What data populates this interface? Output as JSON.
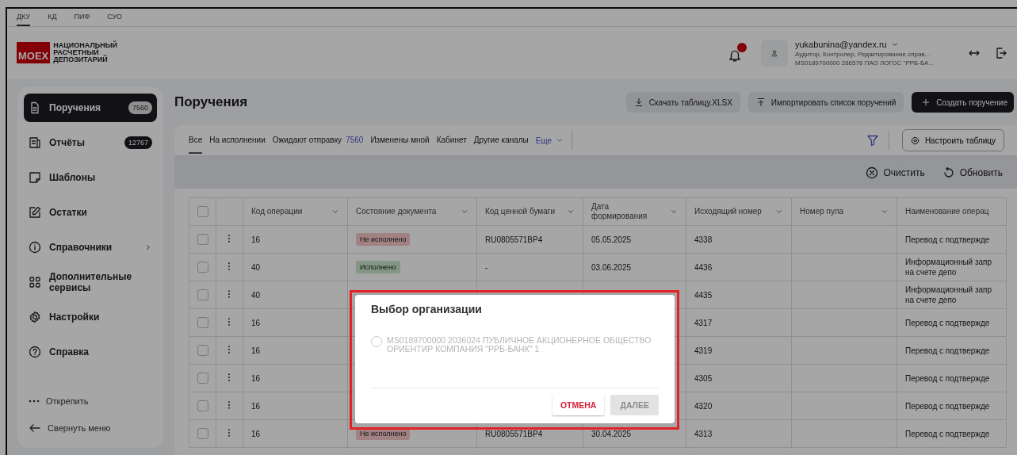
{
  "env_tabs": [
    {
      "label": "ДКУ",
      "selected": true
    },
    {
      "label": "КД",
      "selected": false
    },
    {
      "label": "ПИФ",
      "selected": false
    },
    {
      "label": "СУО",
      "selected": false
    }
  ],
  "logo": {
    "mark": "MOEX",
    "lines": [
      "НАЦИОНАЛЬНЫЙ",
      "РАСЧЕТНЫЙ",
      "ДЕПОЗИТАРИЙ"
    ]
  },
  "user": {
    "email": "yukabunina@yandex.ru",
    "roles": "Аудитор, Контролер, Редактирование справ...",
    "org": "MS0189700000 286576 ПАО ЛОГОС \"РРБ-БА..."
  },
  "sidebar": {
    "items": [
      {
        "label": "Поручения",
        "badge": "7560",
        "selected": true,
        "submenu": false
      },
      {
        "label": "Отчёты",
        "badge": "12767",
        "selected": false,
        "submenu": false
      },
      {
        "label": "Шаблоны",
        "selected": false,
        "submenu": false
      },
      {
        "label": "Остатки",
        "selected": false,
        "submenu": false
      },
      {
        "label": "Справочники",
        "selected": false,
        "submenu": true
      },
      {
        "label": "Дополнительные сервисы",
        "selected": false,
        "submenu": false
      },
      {
        "label": "Настройки",
        "selected": false,
        "submenu": false
      },
      {
        "label": "Справка",
        "selected": false,
        "submenu": false
      }
    ],
    "actions": [
      {
        "label": "Открепить"
      },
      {
        "label": "Свернуть меню"
      }
    ]
  },
  "page_title": "Поручения",
  "buttons": [
    {
      "kind": "download",
      "label": "Скачать таблицу.XLSX"
    },
    {
      "kind": "upload",
      "label": "Импортировать список поручений"
    },
    {
      "kind": "create",
      "label": "Создать поручение"
    }
  ],
  "filter_tabs": [
    {
      "label": "Все",
      "selected": true
    },
    {
      "label": "На исполнении",
      "selected": false
    },
    {
      "label": "Ожидают отправку",
      "count": "7560",
      "selected": false
    },
    {
      "label": "Изменены мной",
      "selected": false
    },
    {
      "label": "Кабинет",
      "selected": false
    },
    {
      "label": "Другие каналы",
      "selected": false
    }
  ],
  "more_link": "Еще",
  "configure_button": "Настроить таблицу",
  "clear_button": "Очистить",
  "refresh_button": "Обновить",
  "table": {
    "all_checked": false,
    "columns": [
      {
        "label": "Код операции",
        "sortable": true
      },
      {
        "label": "Состояние документа",
        "sortable": true
      },
      {
        "label": "Код ценной бумаги",
        "sortable": true
      },
      {
        "label": "Дата формирования",
        "sortable": true
      },
      {
        "label": "Исходящий номер",
        "sortable": true
      },
      {
        "label": "Номер пула",
        "sortable": true
      },
      {
        "label": "Наименование операц",
        "sortable": false
      }
    ],
    "rows": [
      {
        "checked": false,
        "code": "16",
        "status": {
          "kind": "failed",
          "label": "Не исполнено"
        },
        "security": "RU0805571BP4",
        "date": "05.05.2025",
        "number": "4338",
        "name": "Перевод с подтвержде"
      },
      {
        "checked": false,
        "code": "40",
        "status": {
          "kind": "done",
          "label": "Исполнено"
        },
        "security": "-",
        "date": "03.06.2025",
        "number": "4436",
        "name": "Информационный запр на счете депо"
      },
      {
        "checked": false,
        "code": "40",
        "number": "4435",
        "name": "Информационный запр на счете депо"
      },
      {
        "checked": false,
        "code": "16",
        "number": "4317",
        "name": "Перевод с подтвержде"
      },
      {
        "checked": false,
        "code": "16",
        "number": "4319",
        "name": "Перевод с подтвержде"
      },
      {
        "checked": false,
        "code": "16",
        "number": "4305",
        "name": "Перевод с подтвержде"
      },
      {
        "checked": false,
        "code": "16",
        "number": "4320",
        "name": "Перевод с подтвержде"
      },
      {
        "checked": false,
        "code": "16",
        "status": {
          "kind": "failed",
          "label": "Не исполнено"
        },
        "security": "RU0805571BP4",
        "date": "30.04.2025",
        "number": "4313",
        "name": "Перевод с подтвержде"
      }
    ]
  },
  "dialog": {
    "title": "Выбор организации",
    "options": [
      {
        "label": "MS0189700000 2036024 ПУБЛИЧНОЕ АКЦИОНЕРНОЕ ОБЩЕСТВО ОРИЕНТИР КОМПАНИЯ \"РРБ-БАНК\" 1",
        "selected": false,
        "disabled": true
      }
    ],
    "cancel": "ОТМЕНА",
    "next": {
      "label": "ДАЛЕЕ",
      "disabled": true
    }
  }
}
